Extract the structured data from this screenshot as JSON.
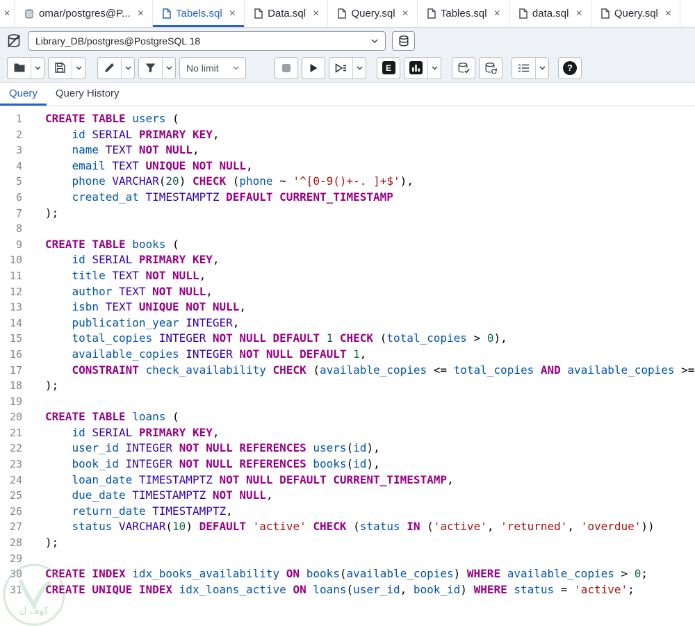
{
  "colors": {
    "accent": "#2262d3",
    "keyword": "#990088",
    "type": "#3300aa",
    "identifier": "#0055aa",
    "number": "#116644",
    "string": "#aa1111"
  },
  "icons": {
    "close": "×",
    "explain": "E",
    "help": "?"
  },
  "tabbar": {
    "tabs": [
      {
        "label": "omar/postgres@P...",
        "icon": "server-icon",
        "active": false
      },
      {
        "label": "Tabels.sql",
        "icon": "file-icon",
        "active": true
      },
      {
        "label": "Data.sql",
        "icon": "file-icon",
        "active": false
      },
      {
        "label": "Query.sql",
        "icon": "file-icon",
        "active": false
      },
      {
        "label": "Tables.sql",
        "icon": "file-icon",
        "active": false
      },
      {
        "label": "data.sql",
        "icon": "file-icon",
        "active": false
      },
      {
        "label": "Query.sql",
        "icon": "file-icon",
        "active": false
      }
    ]
  },
  "connection": {
    "selected": "Library_DB/postgres@PostgreSQL 18"
  },
  "toolbar": {
    "limit": "No limit"
  },
  "panel_tabs": {
    "query": "Query",
    "history": "Query History"
  },
  "watermark": {
    "text": "كهف ل"
  },
  "editor": {
    "lines": [
      [
        [
          "k",
          "CREATE TABLE"
        ],
        [
          "p",
          " "
        ],
        [
          "c",
          "users"
        ],
        [
          "p",
          " ("
        ]
      ],
      [
        [
          "p",
          "    "
        ],
        [
          "c",
          "id"
        ],
        [
          "p",
          " "
        ],
        [
          "b",
          "SERIAL"
        ],
        [
          "p",
          " "
        ],
        [
          "k",
          "PRIMARY KEY"
        ],
        [
          "p",
          ","
        ]
      ],
      [
        [
          "p",
          "    "
        ],
        [
          "c",
          "name"
        ],
        [
          "p",
          " "
        ],
        [
          "b",
          "TEXT"
        ],
        [
          "p",
          " "
        ],
        [
          "k",
          "NOT NULL"
        ],
        [
          "p",
          ","
        ]
      ],
      [
        [
          "p",
          "    "
        ],
        [
          "c",
          "email"
        ],
        [
          "p",
          " "
        ],
        [
          "b",
          "TEXT"
        ],
        [
          "p",
          " "
        ],
        [
          "k",
          "UNIQUE NOT NULL"
        ],
        [
          "p",
          ","
        ]
      ],
      [
        [
          "p",
          "    "
        ],
        [
          "c",
          "phone"
        ],
        [
          "p",
          " "
        ],
        [
          "b",
          "VARCHAR"
        ],
        [
          "p",
          "("
        ],
        [
          "n",
          "20"
        ],
        [
          "p",
          ") "
        ],
        [
          "k",
          "CHECK"
        ],
        [
          "p",
          " ("
        ],
        [
          "c",
          "phone"
        ],
        [
          "p",
          " ~ "
        ],
        [
          "s",
          "'^[0-9()+-. ]+$'"
        ],
        [
          "p",
          "),"
        ]
      ],
      [
        [
          "p",
          "    "
        ],
        [
          "c",
          "created_at"
        ],
        [
          "p",
          " "
        ],
        [
          "b",
          "TIMESTAMPTZ"
        ],
        [
          "p",
          " "
        ],
        [
          "k",
          "DEFAULT CURRENT_TIMESTAMP"
        ]
      ],
      [
        [
          "p",
          ");"
        ]
      ],
      [],
      [
        [
          "k",
          "CREATE TABLE"
        ],
        [
          "p",
          " "
        ],
        [
          "c",
          "books"
        ],
        [
          "p",
          " ("
        ]
      ],
      [
        [
          "p",
          "    "
        ],
        [
          "c",
          "id"
        ],
        [
          "p",
          " "
        ],
        [
          "b",
          "SERIAL"
        ],
        [
          "p",
          " "
        ],
        [
          "k",
          "PRIMARY KEY"
        ],
        [
          "p",
          ","
        ]
      ],
      [
        [
          "p",
          "    "
        ],
        [
          "c",
          "title"
        ],
        [
          "p",
          " "
        ],
        [
          "b",
          "TEXT"
        ],
        [
          "p",
          " "
        ],
        [
          "k",
          "NOT NULL"
        ],
        [
          "p",
          ","
        ]
      ],
      [
        [
          "p",
          "    "
        ],
        [
          "c",
          "author"
        ],
        [
          "p",
          " "
        ],
        [
          "b",
          "TEXT"
        ],
        [
          "p",
          " "
        ],
        [
          "k",
          "NOT NULL"
        ],
        [
          "p",
          ","
        ]
      ],
      [
        [
          "p",
          "    "
        ],
        [
          "c",
          "isbn"
        ],
        [
          "p",
          " "
        ],
        [
          "b",
          "TEXT"
        ],
        [
          "p",
          " "
        ],
        [
          "k",
          "UNIQUE NOT NULL"
        ],
        [
          "p",
          ","
        ]
      ],
      [
        [
          "p",
          "    "
        ],
        [
          "c",
          "publication_year"
        ],
        [
          "p",
          " "
        ],
        [
          "b",
          "INTEGER"
        ],
        [
          "p",
          ","
        ]
      ],
      [
        [
          "p",
          "    "
        ],
        [
          "c",
          "total_copies"
        ],
        [
          "p",
          " "
        ],
        [
          "b",
          "INTEGER"
        ],
        [
          "p",
          " "
        ],
        [
          "k",
          "NOT NULL DEFAULT"
        ],
        [
          "p",
          " "
        ],
        [
          "n",
          "1"
        ],
        [
          "p",
          " "
        ],
        [
          "k",
          "CHECK"
        ],
        [
          "p",
          " ("
        ],
        [
          "c",
          "total_copies"
        ],
        [
          "p",
          " > "
        ],
        [
          "n",
          "0"
        ],
        [
          "p",
          "),"
        ]
      ],
      [
        [
          "p",
          "    "
        ],
        [
          "c",
          "available_copies"
        ],
        [
          "p",
          " "
        ],
        [
          "b",
          "INTEGER"
        ],
        [
          "p",
          " "
        ],
        [
          "k",
          "NOT NULL DEFAULT"
        ],
        [
          "p",
          " "
        ],
        [
          "n",
          "1"
        ],
        [
          "p",
          ","
        ]
      ],
      [
        [
          "p",
          "    "
        ],
        [
          "k",
          "CONSTRAINT"
        ],
        [
          "p",
          " "
        ],
        [
          "c",
          "check_availability"
        ],
        [
          "p",
          " "
        ],
        [
          "k",
          "CHECK"
        ],
        [
          "p",
          " ("
        ],
        [
          "c",
          "available_copies"
        ],
        [
          "p",
          " <= "
        ],
        [
          "c",
          "total_copies"
        ],
        [
          "p",
          " "
        ],
        [
          "k",
          "AND"
        ],
        [
          "p",
          " "
        ],
        [
          "c",
          "available_copies"
        ],
        [
          "p",
          " >="
        ]
      ],
      [
        [
          "p",
          ");"
        ]
      ],
      [],
      [
        [
          "k",
          "CREATE TABLE"
        ],
        [
          "p",
          " "
        ],
        [
          "c",
          "loans"
        ],
        [
          "p",
          " ("
        ]
      ],
      [
        [
          "p",
          "    "
        ],
        [
          "c",
          "id"
        ],
        [
          "p",
          " "
        ],
        [
          "b",
          "SERIAL"
        ],
        [
          "p",
          " "
        ],
        [
          "k",
          "PRIMARY KEY"
        ],
        [
          "p",
          ","
        ]
      ],
      [
        [
          "p",
          "    "
        ],
        [
          "c",
          "user_id"
        ],
        [
          "p",
          " "
        ],
        [
          "b",
          "INTEGER"
        ],
        [
          "p",
          " "
        ],
        [
          "k",
          "NOT NULL REFERENCES"
        ],
        [
          "p",
          " "
        ],
        [
          "c",
          "users"
        ],
        [
          "p",
          "("
        ],
        [
          "c",
          "id"
        ],
        [
          "p",
          "),"
        ]
      ],
      [
        [
          "p",
          "    "
        ],
        [
          "c",
          "book_id"
        ],
        [
          "p",
          " "
        ],
        [
          "b",
          "INTEGER"
        ],
        [
          "p",
          " "
        ],
        [
          "k",
          "NOT NULL REFERENCES"
        ],
        [
          "p",
          " "
        ],
        [
          "c",
          "books"
        ],
        [
          "p",
          "("
        ],
        [
          "c",
          "id"
        ],
        [
          "p",
          "),"
        ]
      ],
      [
        [
          "p",
          "    "
        ],
        [
          "c",
          "loan_date"
        ],
        [
          "p",
          " "
        ],
        [
          "b",
          "TIMESTAMPTZ"
        ],
        [
          "p",
          " "
        ],
        [
          "k",
          "NOT NULL DEFAULT CURRENT_TIMESTAMP"
        ],
        [
          "p",
          ","
        ]
      ],
      [
        [
          "p",
          "    "
        ],
        [
          "c",
          "due_date"
        ],
        [
          "p",
          " "
        ],
        [
          "b",
          "TIMESTAMPTZ"
        ],
        [
          "p",
          " "
        ],
        [
          "k",
          "NOT NULL"
        ],
        [
          "p",
          ","
        ]
      ],
      [
        [
          "p",
          "    "
        ],
        [
          "c",
          "return_date"
        ],
        [
          "p",
          " "
        ],
        [
          "b",
          "TIMESTAMPTZ"
        ],
        [
          "p",
          ","
        ]
      ],
      [
        [
          "p",
          "    "
        ],
        [
          "c",
          "status"
        ],
        [
          "p",
          " "
        ],
        [
          "b",
          "VARCHAR"
        ],
        [
          "p",
          "("
        ],
        [
          "n",
          "10"
        ],
        [
          "p",
          ") "
        ],
        [
          "k",
          "DEFAULT"
        ],
        [
          "p",
          " "
        ],
        [
          "s",
          "'active'"
        ],
        [
          "p",
          " "
        ],
        [
          "k",
          "CHECK"
        ],
        [
          "p",
          " ("
        ],
        [
          "c",
          "status"
        ],
        [
          "p",
          " "
        ],
        [
          "k",
          "IN"
        ],
        [
          "p",
          " ("
        ],
        [
          "s",
          "'active'"
        ],
        [
          "p",
          ", "
        ],
        [
          "s",
          "'returned'"
        ],
        [
          "p",
          ", "
        ],
        [
          "s",
          "'overdue'"
        ],
        [
          "p",
          "))"
        ]
      ],
      [
        [
          "p",
          ");"
        ]
      ],
      [],
      [
        [
          "k",
          "CREATE INDEX"
        ],
        [
          "p",
          " "
        ],
        [
          "c",
          "idx_books_availability"
        ],
        [
          "p",
          " "
        ],
        [
          "k",
          "ON"
        ],
        [
          "p",
          " "
        ],
        [
          "c",
          "books"
        ],
        [
          "p",
          "("
        ],
        [
          "c",
          "available_copies"
        ],
        [
          "p",
          ") "
        ],
        [
          "k",
          "WHERE"
        ],
        [
          "p",
          " "
        ],
        [
          "c",
          "available_copies"
        ],
        [
          "p",
          " > "
        ],
        [
          "n",
          "0"
        ],
        [
          "p",
          ";"
        ]
      ],
      [
        [
          "k",
          "CREATE UNIQUE INDEX"
        ],
        [
          "p",
          " "
        ],
        [
          "c",
          "idx_loans_active"
        ],
        [
          "p",
          " "
        ],
        [
          "k",
          "ON"
        ],
        [
          "p",
          " "
        ],
        [
          "c",
          "loans"
        ],
        [
          "p",
          "("
        ],
        [
          "c",
          "user_id"
        ],
        [
          "p",
          ", "
        ],
        [
          "c",
          "book_id"
        ],
        [
          "p",
          ") "
        ],
        [
          "k",
          "WHERE"
        ],
        [
          "p",
          " "
        ],
        [
          "c",
          "status"
        ],
        [
          "p",
          " = "
        ],
        [
          "s",
          "'active'"
        ],
        [
          "p",
          ";"
        ]
      ]
    ]
  }
}
